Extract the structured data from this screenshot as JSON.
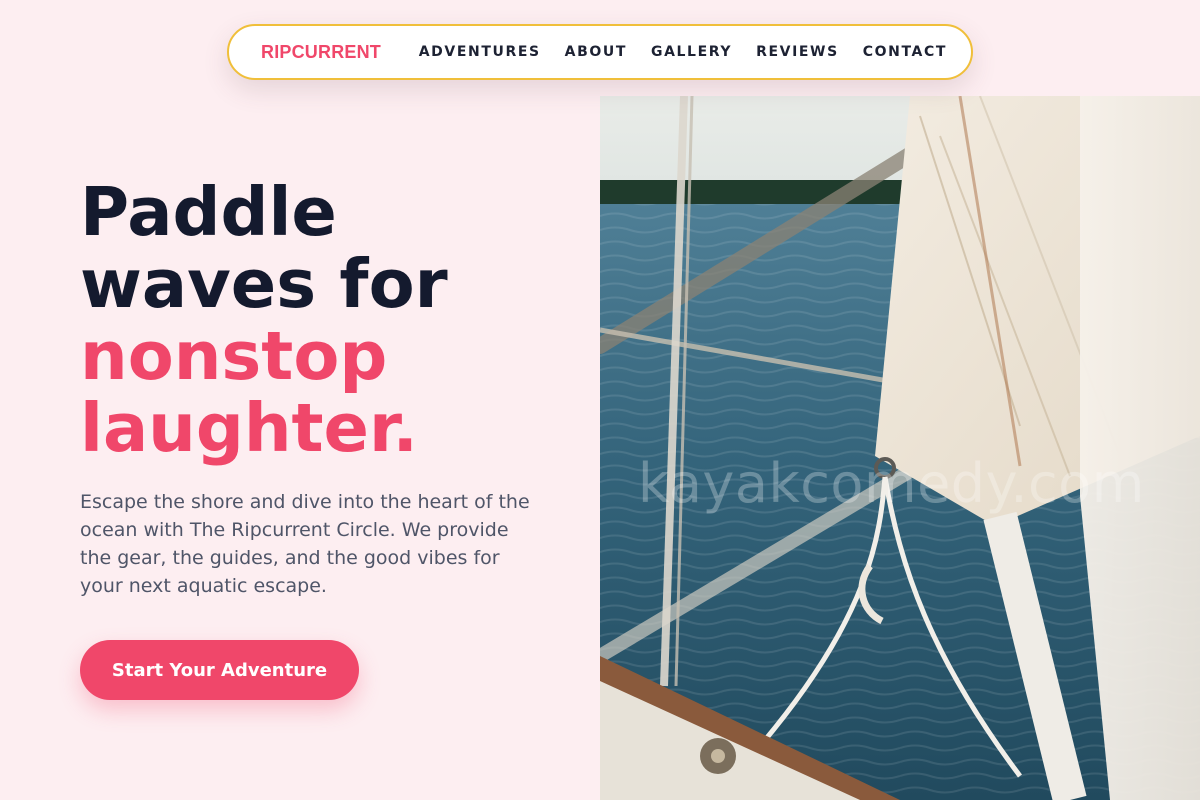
{
  "nav": {
    "brand": "RIPCURRENT",
    "links": [
      "ADVENTURES",
      "ABOUT",
      "GALLERY",
      "REVIEWS",
      "CONTACT"
    ],
    "border_color": "#f0bf3a"
  },
  "hero": {
    "headline_lines": [
      "Paddle",
      "waves for"
    ],
    "headline_accent_lines": [
      "nonstop",
      "laughter."
    ],
    "subtext": "Escape the shore and dive into the heart of the ocean with The Ripcurrent Circle. We provide the gear, the guides, and the good vibes for your next aquatic escape.",
    "cta_label": "Start Your Adventure",
    "image_watermark": "kayakcomedy.com"
  },
  "colors": {
    "background": "#fdeef1",
    "accent": "#f0476a",
    "heading": "#141a2e",
    "body_text": "#4f5568"
  }
}
